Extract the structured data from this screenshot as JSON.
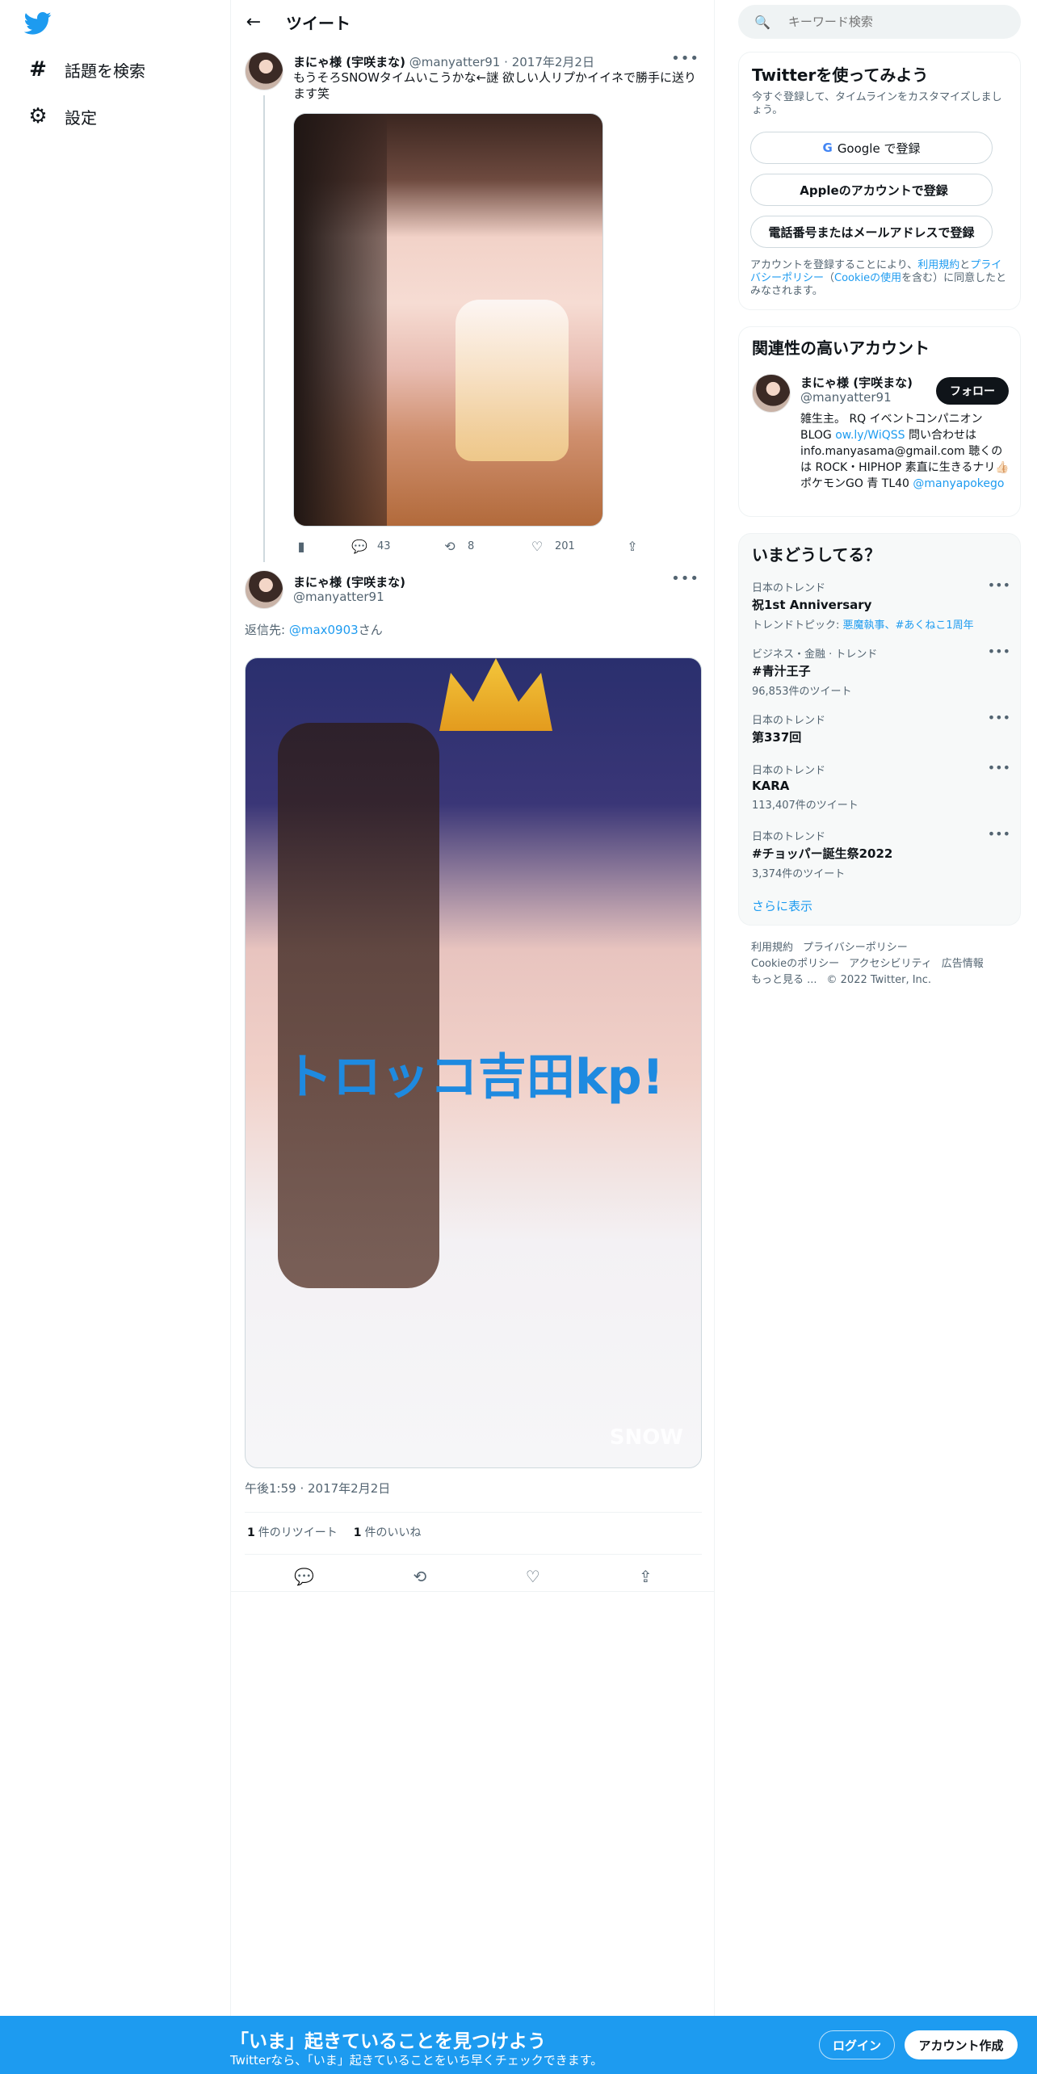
{
  "nav": {
    "logo": "twitter-bird",
    "items": [
      {
        "icon": "hashtag-icon",
        "glyph": "#",
        "label": "話題を検索"
      },
      {
        "icon": "gear-icon",
        "glyph": "⚙",
        "label": "設定"
      }
    ]
  },
  "header": {
    "title": "ツイート"
  },
  "tweet1": {
    "name": "まにゃ様 (宇咲まな)",
    "handle": "@manyatter91",
    "separator": "·",
    "date": "2017年2月2日",
    "text": "もうそろSNOWタイムいこうかな←謎 欲しい人リプかイイネで勝手に送ります笑",
    "replies": "43",
    "retweets": "8",
    "likes": "201"
  },
  "tweet2": {
    "name": "まにゃ様 (宇咲まな)",
    "handle": "@manyatter91",
    "reply_prefix": "返信先: ",
    "reply_to": "@max0903",
    "reply_suffix": "さん",
    "image_text": "トロッコ吉田kp!",
    "watermark": "SNOW",
    "timestamp": "午後1:59 · 2017年2月2日",
    "retweet_count": "1",
    "retweet_label": "件のリツイート",
    "like_count": "1",
    "like_label": "件のいいね"
  },
  "search": {
    "placeholder": "キーワード検索"
  },
  "signup_card": {
    "title": "Twitterを使ってみよう",
    "subtitle": "今すぐ登録して、タイムラインをカスタマイズしましょう。",
    "google_button": "Google で登録",
    "apple_button": "Appleのアカウントで登録",
    "email_button": "電話番号またはメールアドレスで登録",
    "legal_prefix": "アカウントを登録することにより、",
    "legal_terms": "利用規約",
    "legal_and": "と",
    "legal_privacy": "プライバシーポリシー",
    "legal_open": "（",
    "legal_cookie": "Cookieの使用",
    "legal_suffix": "を含む）に同意したとみなされます。"
  },
  "related_card": {
    "title": "関連性の高いアカウント",
    "name": "まにゃ様 (宇咲まな)",
    "handle": "@manyatter91",
    "follow": "フォロー",
    "bio_a": "雑生主。 RQ イベントコンパニオン BLOG ",
    "bio_link": "ow.ly/WiQSS",
    "bio_b": " 問い合わせは info.manyasama@gmail.com 聴くのは ROCK・HIPHOP 素直に生きるナリ👍🏻 ポケモンGO 青 TL40 ",
    "bio_mention": "@manyapokego"
  },
  "trends_card": {
    "title": "いまどうしてる？",
    "items": [
      {
        "meta": "日本のトレンド",
        "name": "祝1st Anniversary",
        "sub_prefix": "トレンドトピック: ",
        "sub_links": "悪魔執事、#あくねこ1周年"
      },
      {
        "meta": "ビジネス・金融 · トレンド",
        "name": "#青汁王子",
        "sub": "96,853件のツイート"
      },
      {
        "meta": "日本のトレンド",
        "name": "第337回",
        "sub": ""
      },
      {
        "meta": "日本のトレンド",
        "name": "KARA",
        "sub": "113,407件のツイート"
      },
      {
        "meta": "日本のトレンド",
        "name": "#チョッパー誕生祭2022",
        "sub": "3,374件のツイート"
      }
    ],
    "show_more": "さらに表示"
  },
  "footer": {
    "terms": "利用規約",
    "privacy": "プライバシーポリシー",
    "cookie": "Cookieのポリシー",
    "accessibility": "アクセシビリティ",
    "ads": "広告情報",
    "more": "もっと見る ...",
    "copyright": "© 2022 Twitter, Inc."
  },
  "bottom_bar": {
    "title": "「いま」起きていることを見つけよう",
    "subtitle": "Twitterなら、「いま」起きていることをいち早くチェックできます。",
    "login": "ログイン",
    "signup": "アカウント作成"
  },
  "colors": {
    "accent": "#1d9bf0",
    "text": "#0f1419",
    "muted": "#536471"
  }
}
